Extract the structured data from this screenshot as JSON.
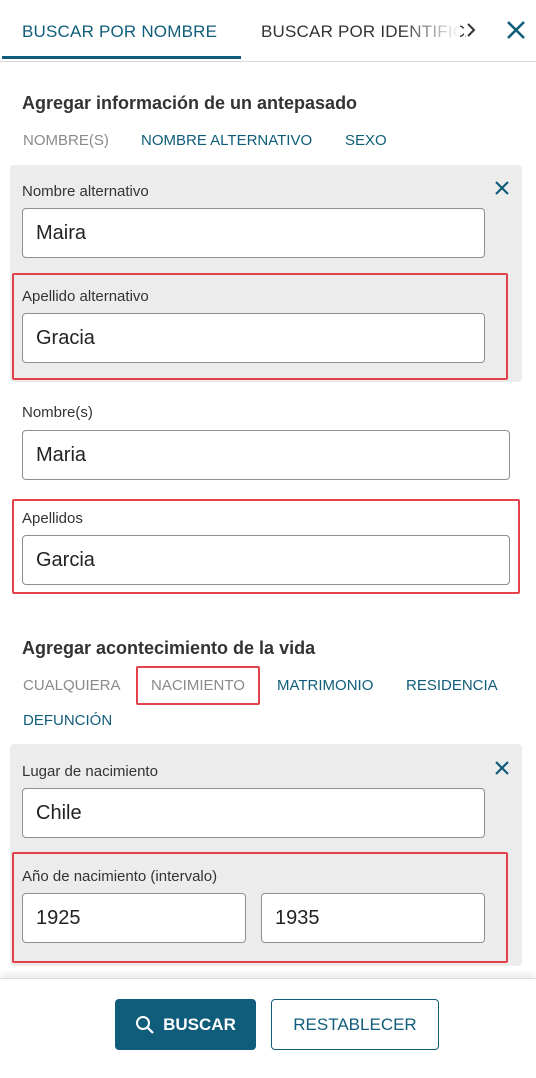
{
  "tabs": {
    "active": "BUSCAR POR NOMBRE",
    "inactive": "BUSCAR POR IDENTIFICADOR"
  },
  "ancestor": {
    "heading": "Agregar información de un antepasado",
    "links": [
      "NOMBRE(S)",
      "NOMBRE ALTERNATIVO",
      "SEXO"
    ]
  },
  "alt_name_panel": {
    "alt_first_label": "Nombre alternativo",
    "alt_first_value": "Maira",
    "alt_last_label": "Apellido alternativo",
    "alt_last_value": "Gracia"
  },
  "names": {
    "first_label": "Nombre(s)",
    "first_value": "Maria",
    "last_label": "Apellidos",
    "last_value": "Garcia"
  },
  "life_event": {
    "heading": "Agregar acontecimiento de la vida",
    "links": [
      "CUALQUIERA",
      "NACIMIENTO",
      "MATRIMONIO",
      "RESIDENCIA",
      "DEFUNCIÓN"
    ]
  },
  "birth_panel": {
    "place_label": "Lugar de nacimiento",
    "place_value": "Chile",
    "year_label": "Año de nacimiento (intervalo)",
    "year_from": "1925",
    "year_to": "1935"
  },
  "footer": {
    "search_label": "BUSCAR",
    "reset_label": "RESTABLECER"
  },
  "colors": {
    "accent": "#0f5d7a",
    "highlight": "#e2434b",
    "panel": "#ececec"
  }
}
